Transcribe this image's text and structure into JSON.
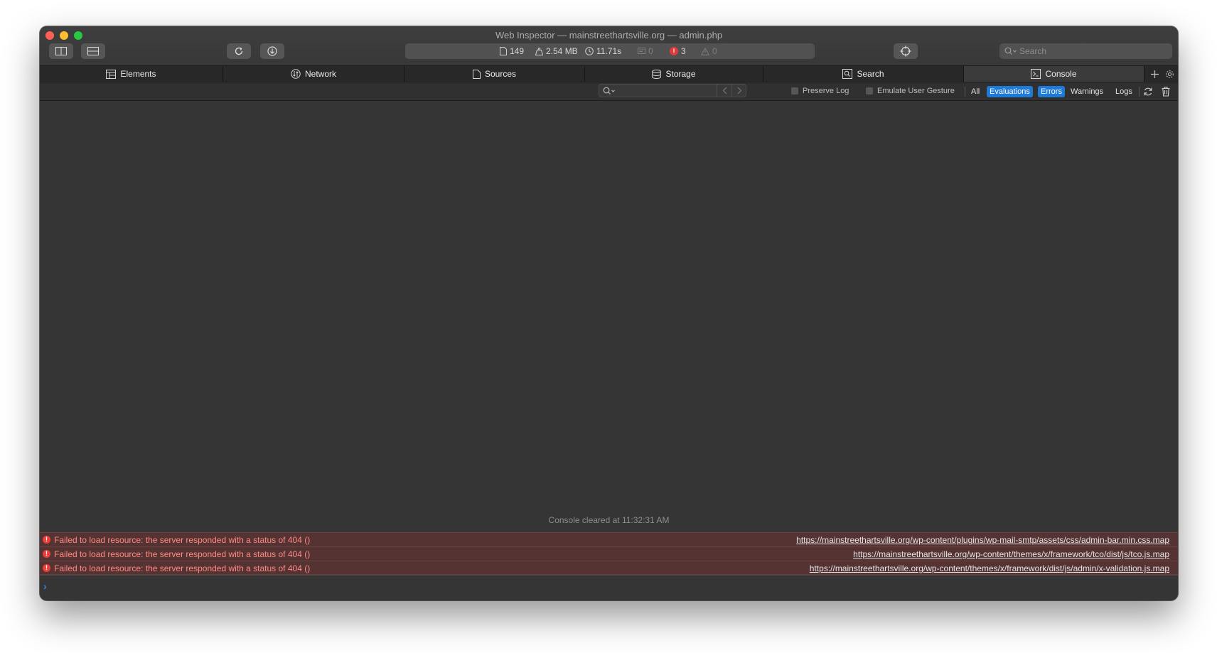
{
  "window": {
    "title": "Web Inspector — mainstreethartsville.org — admin.php"
  },
  "toolbar": {
    "icons": [
      "dock-side-icon",
      "dock-bottom-icon",
      "reload-icon",
      "download-icon",
      "target-icon"
    ],
    "activity": {
      "resources": "149",
      "size": "2.54 MB",
      "time": "11.71s",
      "logs": "0",
      "errors": "3",
      "warnings": "0"
    },
    "search_placeholder": "Search"
  },
  "tabs": [
    {
      "label": "Elements",
      "icon": "elements-icon"
    },
    {
      "label": "Network",
      "icon": "network-icon"
    },
    {
      "label": "Sources",
      "icon": "sources-icon"
    },
    {
      "label": "Storage",
      "icon": "storage-icon"
    },
    {
      "label": "Search",
      "icon": "search-icon"
    },
    {
      "label": "Console",
      "icon": "console-icon",
      "active": true
    }
  ],
  "filter": {
    "search_value": "",
    "preserve_log": "Preserve Log",
    "emulate_gesture": "Emulate User Gesture",
    "levels": [
      {
        "label": "All",
        "active": false
      },
      {
        "label": "Evaluations",
        "active": true
      },
      {
        "label": "Errors",
        "active": true
      },
      {
        "label": "Warnings",
        "active": false
      },
      {
        "label": "Logs",
        "active": false
      }
    ]
  },
  "console": {
    "cleared_text": "Console cleared at 11:32:31 AM",
    "messages": [
      {
        "text": "Failed to load resource: the server responded with a status of 404 ()",
        "url": "https://mainstreethartsville.org/wp-content/plugins/wp-mail-smtp/assets/css/admin-bar.min.css.map"
      },
      {
        "text": "Failed to load resource: the server responded with a status of 404 ()",
        "url": "https://mainstreethartsville.org/wp-content/themes/x/framework/tco/dist/js/tco.js.map"
      },
      {
        "text": "Failed to load resource: the server responded with a status of 404 ()",
        "url": "https://mainstreethartsville.org/wp-content/themes/x/framework/dist/js/admin/x-validation.js.map"
      }
    ],
    "prompt": "›"
  },
  "colors": {
    "accent": "#1e7ad6",
    "error_text": "#ff8a84",
    "error_bg": "#553332",
    "panel_bg": "#353535"
  }
}
